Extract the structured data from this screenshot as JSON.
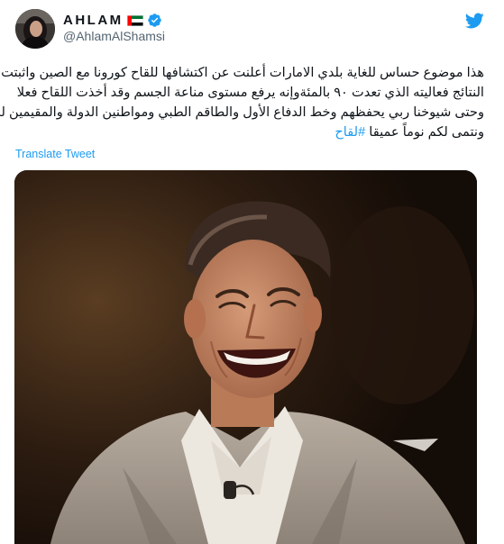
{
  "author": {
    "display_name": "AHLAM",
    "handle": "@AhlamAlShamsi",
    "verified": true,
    "flag": "uae-flag"
  },
  "tweet": {
    "lines": [
      "هذا موضوع حساس للغاية بلدي الامارات أعلنت عن اكتشافها للقاح كورونا مع الصين واثبتت",
      "النتائج فعاليته الذي تعدت ٩٠ بالمئةوإنه يرفع مستوى مناعة الجسم وقد أخذت اللقاح فعلا",
      "وحتى شيوخنا ربي يحفظهم وخط الدفاع الأول والطاقم الطبي ومواطنين الدولة والمقيمين له"
    ],
    "last_line_text": "ونتمى لكم نوماً عميقا ",
    "hashtag": "#لقاح"
  },
  "translate_label": "Translate Tweet",
  "icons": {
    "brand": "twitter-bird-icon",
    "verified": "verified-badge-icon"
  },
  "colors": {
    "accent": "#1d9bf0",
    "text": "#0f1419",
    "secondary": "#536471"
  }
}
